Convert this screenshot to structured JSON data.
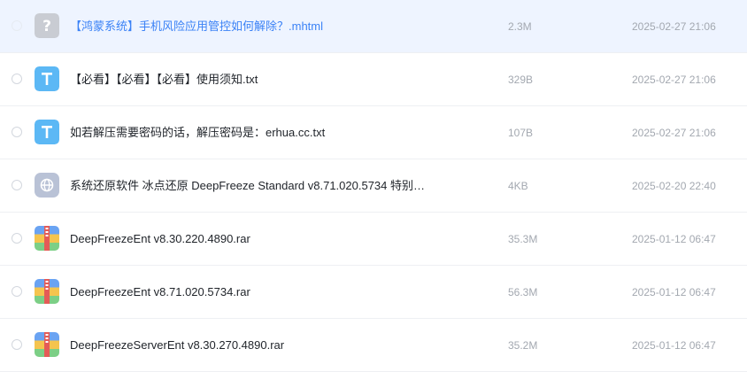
{
  "files": [
    {
      "name": "【鸿蒙系统】手机风险应用管控如何解除？.mhtml",
      "size": "2.3M",
      "date": "2025-02-27 21:06",
      "icon": "unknown-file-icon",
      "selected": true
    },
    {
      "name": "【必看】【必看】【必看】使用须知.txt",
      "size": "329B",
      "date": "2025-02-27 21:06",
      "icon": "text-file-icon",
      "selected": false
    },
    {
      "name": "如若解压需要密码的话，解压密码是：erhua.cc.txt",
      "size": "107B",
      "date": "2025-02-27 21:06",
      "icon": "text-file-icon",
      "selected": false
    },
    {
      "name": "系统还原软件 冰点还原 DeepFreeze Standard v8.71.020.5734 特别…",
      "size": "4KB",
      "date": "2025-02-20 22:40",
      "icon": "link-file-icon",
      "selected": false
    },
    {
      "name": "DeepFreezeEnt v8.30.220.4890.rar",
      "size": "35.3M",
      "date": "2025-01-12 06:47",
      "icon": "archive-file-icon",
      "selected": false
    },
    {
      "name": "DeepFreezeEnt v8.71.020.5734.rar",
      "size": "56.3M",
      "date": "2025-01-12 06:47",
      "icon": "archive-file-icon",
      "selected": false
    },
    {
      "name": "DeepFreezeServerEnt v8.30.270.4890.rar",
      "size": "35.2M",
      "date": "2025-01-12 06:47",
      "icon": "archive-file-icon",
      "selected": false
    }
  ],
  "colors": {
    "selected_row_bg": "#eef4ff",
    "selected_name": "#3b82f6",
    "text_icon": "#5cb8f5",
    "unknown_icon": "#c9ccd3",
    "link_icon": "#b9c2d6",
    "meta_text": "#a3a8b0"
  }
}
